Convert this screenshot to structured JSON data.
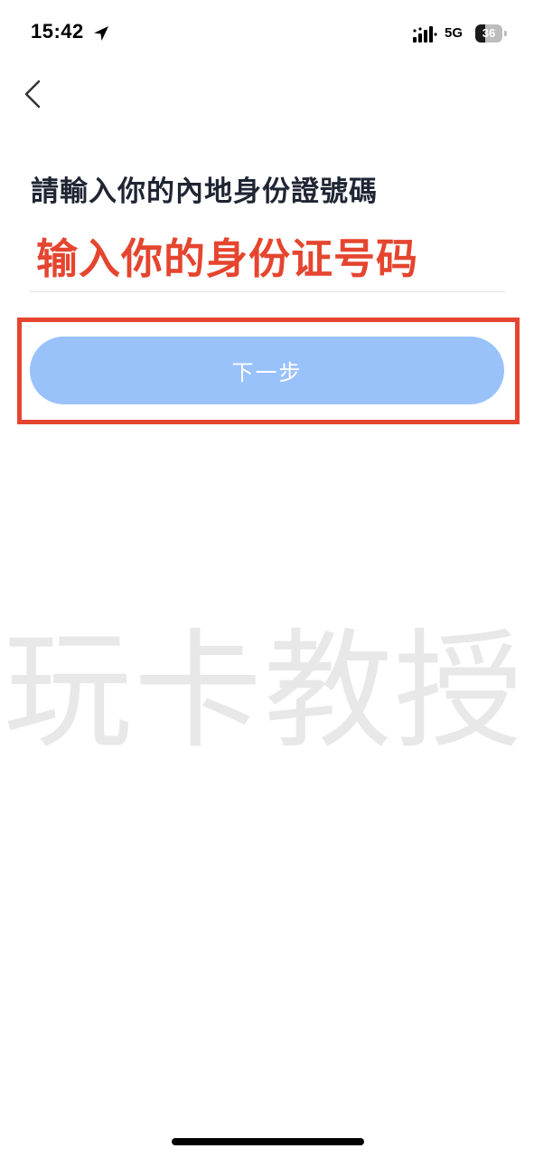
{
  "status_bar": {
    "time": "15:42",
    "network": "5G",
    "battery_level": "36",
    "battery_fraction": 0.36,
    "location_icon": "location-arrow-icon",
    "signal_icon": "cellular-signal-icon"
  },
  "nav": {
    "back_icon": "chevron-left-icon"
  },
  "form": {
    "title": "請輸入你的內地身份證號碼",
    "id_input_value": "",
    "next_button_label": "下一步"
  },
  "annotation": {
    "text": "输入你的身份证号码",
    "color": "#e5452f"
  },
  "watermark": {
    "text": "玩卡教授"
  },
  "colors": {
    "button_background": "#99c2fb",
    "title_text": "#1f2533",
    "highlight": "#e5452f"
  }
}
